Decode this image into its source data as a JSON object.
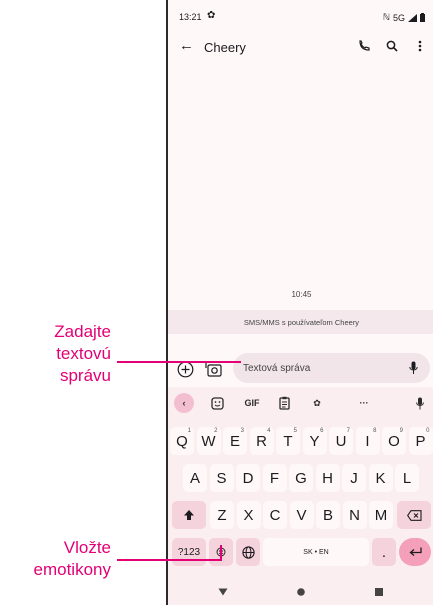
{
  "status_bar": {
    "time": "13:21",
    "network": "5G"
  },
  "app_bar": {
    "contact_name": "Cheery"
  },
  "conversation": {
    "timestamp": "10:45",
    "info_banner": "SMS/MMS s používateľom Cheery"
  },
  "compose": {
    "placeholder": "Textová správa"
  },
  "keyboard": {
    "toolbar": {
      "gif": "GIF",
      "more": "···"
    },
    "row1": [
      {
        "key": "Q",
        "hint": "1"
      },
      {
        "key": "W",
        "hint": "2"
      },
      {
        "key": "E",
        "hint": "3"
      },
      {
        "key": "R",
        "hint": "4"
      },
      {
        "key": "T",
        "hint": "5"
      },
      {
        "key": "Y",
        "hint": "6"
      },
      {
        "key": "U",
        "hint": "7"
      },
      {
        "key": "I",
        "hint": "8"
      },
      {
        "key": "O",
        "hint": "9"
      },
      {
        "key": "P",
        "hint": "0"
      }
    ],
    "row2": [
      "A",
      "S",
      "D",
      "F",
      "G",
      "H",
      "J",
      "K",
      "L"
    ],
    "row3": [
      "Z",
      "X",
      "C",
      "V",
      "B",
      "N",
      "M"
    ],
    "symbols": "?123",
    "space": "SK • EN",
    "period": "."
  },
  "callouts": {
    "text_line1": "Zadajte",
    "text_line2": "textovú",
    "text_line3": "správu",
    "emoji_line1": "Vložte",
    "emoji_line2": "emotikony"
  },
  "colors": {
    "accent": "#e20074",
    "keyboard_bg": "#fbeef1",
    "enter": "#f5a0bb"
  }
}
